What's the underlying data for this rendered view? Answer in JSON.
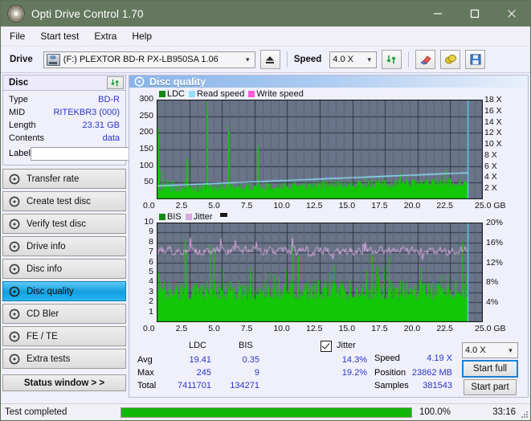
{
  "window": {
    "title": "Opti Drive Control 1.70",
    "icon": "disc-icon",
    "minimize": "minimize-icon",
    "maximize": "maximize-icon",
    "close": "close-icon"
  },
  "menu": {
    "items": [
      "File",
      "Start test",
      "Extra",
      "Help"
    ]
  },
  "toolbar": {
    "drive_label": "Drive",
    "drive_value": "(F:)  PLEXTOR BD-R  PX-LB950SA 1.06",
    "eject": "eject-icon",
    "speed_label": "Speed",
    "speed_value": "4.0 X",
    "refresh": "refresh-icon",
    "erase": "eraser-icon",
    "coin": "coin-icon",
    "save": "save-icon"
  },
  "disc_panel": {
    "title": "Disc",
    "refresh": "refresh-icon",
    "rows": [
      {
        "key": "Type",
        "value": "BD-R"
      },
      {
        "key": "MID",
        "value": "RITEKBR3 (000)"
      },
      {
        "key": "Length",
        "value": "23.31 GB"
      },
      {
        "key": "Contents",
        "value": "data"
      }
    ],
    "label_key": "Label",
    "label_value": "",
    "label_button": "disc-label-icon"
  },
  "nav": {
    "items": [
      {
        "label": "Transfer rate",
        "active": false
      },
      {
        "label": "Create test disc",
        "active": false
      },
      {
        "label": "Verify test disc",
        "active": false
      },
      {
        "label": "Drive info",
        "active": false
      },
      {
        "label": "Disc info",
        "active": false
      },
      {
        "label": "Disc quality",
        "active": true
      },
      {
        "label": "CD Bler",
        "active": false
      },
      {
        "label": "FE / TE",
        "active": false
      },
      {
        "label": "Extra tests",
        "active": false
      }
    ],
    "status_window": "Status window > >"
  },
  "content": {
    "title": "Disc quality",
    "icon": "disc-quality-icon"
  },
  "stats": {
    "col_headers": [
      "LDC",
      "BIS"
    ],
    "jitter_label": "Jitter",
    "jitter_checked": true,
    "rows": [
      {
        "name": "Avg",
        "ldc": "19.41",
        "bis": "0.35",
        "jitter": "14.3%"
      },
      {
        "name": "Max",
        "ldc": "245",
        "bis": "9",
        "jitter": "19.2%"
      },
      {
        "name": "Total",
        "ldc": "7411701",
        "bis": "134271",
        "jitter": ""
      }
    ],
    "speed_label": "Speed",
    "speed_value": "4.19 X",
    "position_label": "Position",
    "position_value": "23862 MB",
    "samples_label": "Samples",
    "samples_value": "381543",
    "speed_select": "4.0 X",
    "start_full": "Start full",
    "start_part": "Start part"
  },
  "statusbar": {
    "message": "Test completed",
    "progress_percent": "100.0%",
    "progress_value": 100,
    "elapsed": "33:16"
  },
  "colors": {
    "title_bar": "#64785e",
    "ldc_green": "#12c706",
    "read_speed": "#8fe3f7",
    "write_speed": "#ff5bd8",
    "jitter_pink": "#d9a8dd",
    "plot_bg": "#6a7489",
    "accent_blue": "#2c35c8",
    "progress_green": "#12b50a"
  },
  "chart_data": [
    {
      "type": "area",
      "title": "LDC / Read speed",
      "legend": [
        {
          "label": "LDC",
          "color": "#118a11"
        },
        {
          "label": "Read speed",
          "color": "#8fe3f7"
        },
        {
          "label": "Write speed",
          "color": "#ff5bd8"
        }
      ],
      "legend_position": "top-left",
      "xlabel": "GB",
      "x_ticks": [
        "0.0",
        "2.5",
        "5.0",
        "7.5",
        "10.0",
        "12.5",
        "15.0",
        "17.5",
        "20.0",
        "22.5",
        "25.0 GB"
      ],
      "xlim": [
        0,
        25
      ],
      "ylabel": "LDC",
      "y_ticks": [
        50,
        100,
        150,
        200,
        250,
        300
      ],
      "ylim": [
        0,
        300
      ],
      "y2label": "Speed",
      "y2_ticks": [
        "2 X",
        "4 X",
        "6 X",
        "8 X",
        "10 X",
        "12 X",
        "14 X",
        "16 X",
        "18 X"
      ],
      "y2lim": [
        0,
        18
      ],
      "grid": true,
      "end_marker_x": 23.86,
      "series": [
        {
          "name": "LDC",
          "kind": "bars",
          "color": "#12c706",
          "x": [
            0.05,
            0.2,
            0.35,
            0.5,
            0.65,
            0.8,
            0.95,
            1.1,
            1.25,
            1.4,
            1.55,
            1.7,
            1.85,
            2.0,
            2.15,
            2.3,
            2.45,
            2.6,
            2.75,
            2.9,
            3.05,
            3.2,
            3.35,
            3.5,
            3.65,
            3.8,
            3.95,
            4.1,
            4.25,
            4.4,
            4.55,
            4.7,
            4.85,
            5.0,
            5.15,
            5.3,
            5.45,
            5.6,
            5.75,
            5.9,
            6.05,
            6.2,
            6.35,
            6.5,
            6.65,
            6.8,
            6.95,
            7.1,
            7.25,
            7.4,
            7.55,
            7.7,
            7.85,
            8.0,
            8.15,
            8.3,
            8.45,
            8.6,
            8.75,
            8.9,
            9.05,
            9.2,
            9.35,
            9.5,
            9.65,
            9.8,
            9.95,
            10.1,
            10.25,
            10.4,
            10.55,
            10.7,
            10.85,
            11.0,
            11.15,
            11.3,
            11.45,
            11.6,
            11.75,
            11.9,
            12.05,
            12.2,
            12.35,
            12.5,
            12.65,
            12.8,
            12.95,
            13.1,
            13.25,
            13.4,
            13.55,
            13.7,
            13.85,
            14.0,
            14.15,
            14.3,
            14.45,
            14.6,
            14.75,
            14.9,
            15.05,
            15.2,
            15.35,
            15.5,
            15.65,
            15.8,
            15.95,
            16.1,
            16.25,
            16.4,
            16.55,
            16.7,
            16.85,
            17.0,
            17.15,
            17.3,
            17.45,
            17.6,
            17.75,
            17.9,
            18.05,
            18.2,
            18.35,
            18.5,
            18.65,
            18.8,
            18.95,
            19.1,
            19.25,
            19.4,
            19.55,
            19.7,
            19.85,
            20.0,
            20.15,
            20.3,
            20.45,
            20.6,
            20.75,
            20.9,
            21.05,
            21.2,
            21.35,
            21.5,
            21.65,
            21.8,
            21.95,
            22.1,
            22.25,
            22.4,
            22.55,
            22.7,
            22.85,
            23.0,
            23.15,
            23.3,
            23.45,
            23.6,
            23.75
          ],
          "values": [
            215,
            98,
            88,
            72,
            66,
            60,
            54,
            50,
            58,
            44,
            40,
            48,
            36,
            34,
            60,
            126,
            44,
            38,
            36,
            34,
            42,
            30,
            36,
            32,
            50,
            296,
            30,
            28,
            34,
            30,
            26,
            34,
            28,
            30,
            26,
            28,
            222,
            30,
            26,
            24,
            28,
            26,
            30,
            24,
            26,
            30,
            24,
            26,
            22,
            26,
            28,
            166,
            24,
            26,
            22,
            28,
            24,
            22,
            26,
            24,
            22,
            26,
            24,
            26,
            28,
            22,
            24,
            26,
            22,
            24,
            26,
            28,
            24,
            22,
            26,
            24,
            28,
            26,
            22,
            24,
            26,
            24,
            28,
            22,
            26,
            60,
            24,
            26,
            22,
            28,
            24,
            26,
            22,
            24,
            28,
            26,
            24,
            22,
            26,
            28,
            24,
            26,
            22,
            28,
            24,
            26,
            70,
            24,
            28,
            26,
            22,
            24,
            28,
            26,
            24,
            30,
            26,
            22,
            28,
            24,
            26,
            24,
            28,
            26,
            80,
            24,
            28,
            26,
            22,
            30,
            26,
            24,
            28,
            26,
            30,
            24,
            28,
            26,
            30,
            28,
            24,
            26,
            30,
            28,
            26,
            24,
            30,
            90,
            28,
            26,
            30,
            24,
            28,
            34,
            30,
            26,
            28,
            32,
            30
          ]
        },
        {
          "name": "Read speed",
          "kind": "line",
          "color": "#8fe3f7",
          "axis": "y2",
          "x": [
            0,
            1,
            2,
            3,
            4,
            5,
            6,
            7,
            8,
            9,
            10,
            11,
            12,
            13,
            14,
            15,
            16,
            17,
            18,
            19,
            20,
            21,
            22,
            23,
            23.86
          ],
          "values": [
            2.4,
            2.5,
            2.6,
            2.7,
            2.8,
            2.9,
            3.0,
            3.1,
            3.2,
            3.3,
            3.4,
            3.5,
            3.6,
            3.7,
            3.8,
            3.9,
            4.0,
            4.1,
            4.2,
            4.3,
            4.4,
            4.5,
            4.6,
            4.7,
            4.75
          ]
        }
      ]
    },
    {
      "type": "area",
      "title": "BIS / Jitter",
      "legend": [
        {
          "label": "BIS",
          "color": "#118a11"
        },
        {
          "label": "Jitter",
          "color": "#d9a8dd"
        }
      ],
      "legend_position": "top-left",
      "xlabel": "GB",
      "x_ticks": [
        "0.0",
        "2.5",
        "5.0",
        "7.5",
        "10.0",
        "12.5",
        "15.0",
        "17.5",
        "20.0",
        "22.5",
        "25.0 GB"
      ],
      "xlim": [
        0,
        25
      ],
      "ylabel": "BIS",
      "y_ticks": [
        1,
        2,
        3,
        4,
        5,
        6,
        7,
        8,
        9,
        10
      ],
      "ylim": [
        0,
        10
      ],
      "y2label": "Jitter",
      "y2_ticks": [
        "4%",
        "8%",
        "12%",
        "16%",
        "20%"
      ],
      "y2lim": [
        0,
        20
      ],
      "grid": true,
      "end_marker_x": 23.86,
      "series": [
        {
          "name": "BIS",
          "kind": "bars",
          "color": "#12c706",
          "baseline_level": 4.0,
          "spike_max": 9,
          "note": "dense bars mostly 3-5 with occasional spikes to 6-9"
        },
        {
          "name": "Jitter",
          "kind": "line",
          "color": "#d9a8dd",
          "axis": "y2",
          "mean_percent": 14.3,
          "max_percent": 19.2,
          "note": "noisy line oscillating roughly 12.5%-18%, spikes near 19%"
        }
      ]
    }
  ]
}
